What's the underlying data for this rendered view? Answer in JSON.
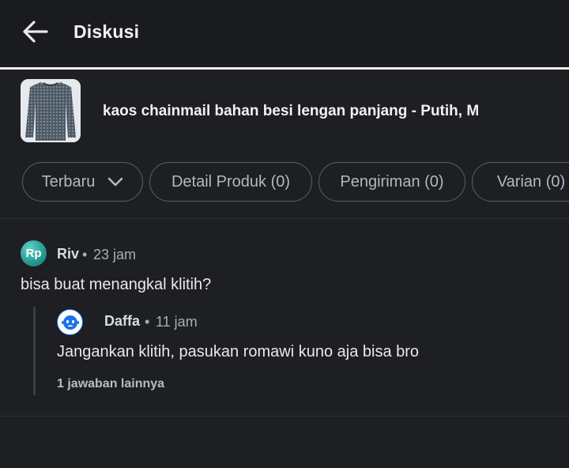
{
  "header": {
    "title": "Diskusi",
    "back_icon": "arrow-left-icon"
  },
  "product": {
    "name": "kaos chainmail bahan besi lengan panjang - Putih, M",
    "thumbnail": "chainmail-shirt-image"
  },
  "filters": [
    {
      "label": "Terbaru",
      "icon": "chevron-down-icon"
    },
    {
      "label": "Detail Produk (0)"
    },
    {
      "label": "Pengiriman (0)"
    },
    {
      "label": "Varian (0)"
    }
  ],
  "comment": {
    "avatar_initials": "Rp",
    "author": "Riv",
    "time": "23 jam",
    "text": "bisa buat menangkal klitih?",
    "separator": "•"
  },
  "reply": {
    "author": "Daffa",
    "time": "11 jam",
    "text": "Jangankan klitih, pasukan romawi kuno aja bisa bro",
    "separator": "•",
    "avatar_icon": "robot-face-icon"
  },
  "more_replies": "1 jawaban lainnya",
  "colors": {
    "background": "#1e1f23",
    "accent_teal": "#1e8f86",
    "accent_blue": "#1a73e8"
  }
}
